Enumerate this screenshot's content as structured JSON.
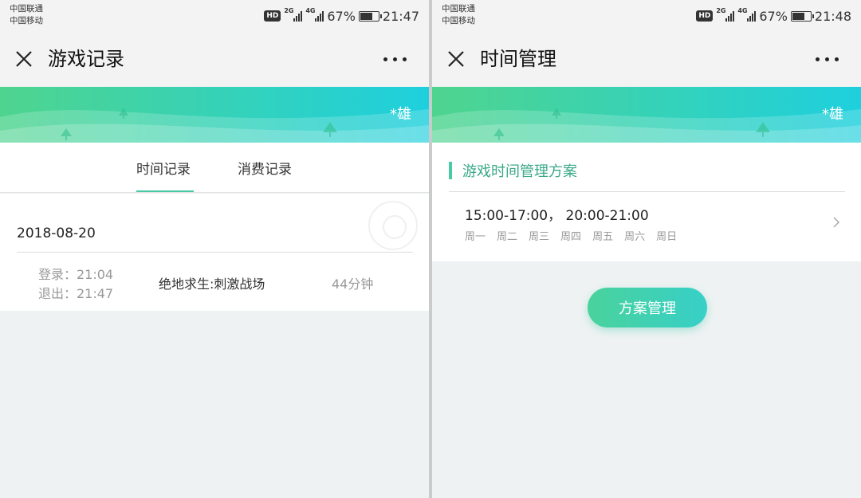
{
  "left": {
    "status": {
      "carrier1": "中国联通",
      "carrier2": "中国移动",
      "hd": "HD",
      "sim1": "2G",
      "sim2": "4G",
      "battery": "67%",
      "battery_level": 0.67,
      "time": "21:47"
    },
    "title": "游戏记录",
    "user_name": "*雄",
    "tabs": [
      {
        "label": "时间记录"
      },
      {
        "label": "消费记录"
      }
    ],
    "active_tab": 0,
    "records": [
      {
        "date": "2018-08-20",
        "login": "登录：21:04",
        "logout": "退出：21:47",
        "game": "绝地求生:刺激战场",
        "duration": "44分钟"
      }
    ]
  },
  "right": {
    "status": {
      "carrier1": "中国联通",
      "carrier2": "中国移动",
      "hd": "HD",
      "sim1": "2G",
      "sim2": "4G",
      "battery": "67%",
      "battery_level": 0.67,
      "time": "21:48"
    },
    "title": "时间管理",
    "user_name": "*雄",
    "plan": {
      "heading": "游戏时间管理方案",
      "times": "15:00-17:00， 20:00-21:00",
      "days": [
        "周一",
        "周二",
        "周三",
        "周四",
        "周五",
        "周六",
        "周日"
      ]
    },
    "button_label": "方案管理"
  },
  "colors": {
    "accent": "#49c9a6",
    "accent_text": "#3aa988",
    "banner_start": "#4fd48e",
    "banner_end": "#1ed0de"
  },
  "icons": {
    "close": "close-icon",
    "more": "more-icon",
    "chevron": "chevron-right-icon",
    "tree": "tree-icon"
  }
}
